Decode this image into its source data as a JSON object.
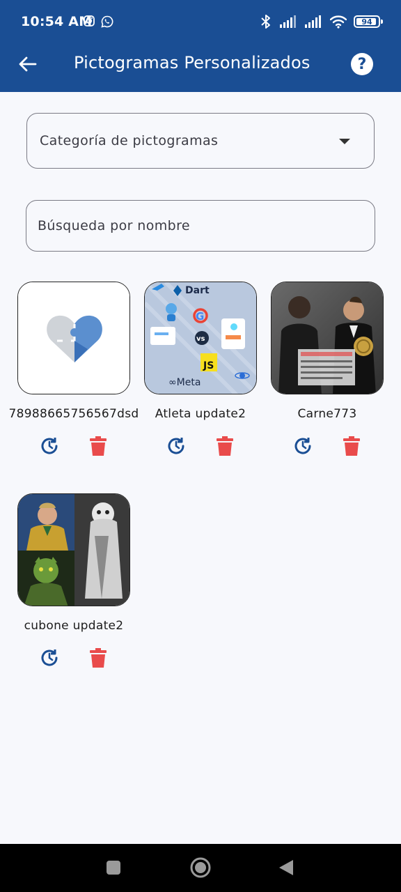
{
  "status_bar": {
    "time": "10:54 AM",
    "battery": "94",
    "battery_level": 0.94
  },
  "app_bar": {
    "title": "Pictogramas Personalizados",
    "back_icon": "arrow-back-icon",
    "help_icon": "help-icon",
    "help_glyph": "?"
  },
  "filters": {
    "category_label": "Categoría de pictogramas",
    "search_placeholder": "Búsqueda por nombre"
  },
  "pictograms": [
    {
      "name": "78988665756567dsd",
      "image": "puzzle-heart-logo"
    },
    {
      "name": "Atleta update2",
      "image": "tech-logos-collage"
    },
    {
      "name": "Carne773",
      "image": "football-players-photo"
    },
    {
      "name": "cubone update2",
      "image": "superheroes-collage"
    }
  ],
  "actions": {
    "update_icon": "update-icon",
    "delete_icon": "delete-icon"
  },
  "colors": {
    "primary": "#1a4e94",
    "delete": "#e94b4b",
    "update": "#1a4e94",
    "background": "#f7f8fc"
  }
}
